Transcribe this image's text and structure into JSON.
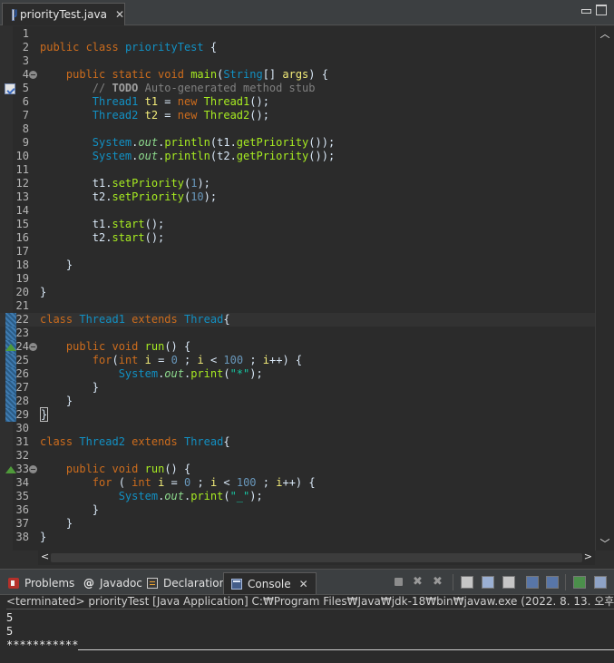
{
  "editor": {
    "tab_title": "priorityTest.java",
    "tab_close": "✕",
    "lines": [
      {
        "n": "1",
        "html": ""
      },
      {
        "n": "2",
        "html": "<span class=\"kw\">public class</span> <span class=\"cls\">priorityTest</span> {"
      },
      {
        "n": "3",
        "html": ""
      },
      {
        "n": "4",
        "html": "    <span class=\"kw\">public static void</span> <span class=\"method\">main</span>(<span class=\"cls\">String</span>[] <span class=\"var\">args</span>) {"
      },
      {
        "n": "5",
        "html": "        <span class=\"cmt\">// <span class=\"todo\">TODO</span> Auto-generated method stub</span>"
      },
      {
        "n": "6",
        "html": "        <span class=\"cls\">Thread1</span> <span class=\"var\">t1</span> = <span class=\"kw\">new</span> <span class=\"method\">Thread1</span>();"
      },
      {
        "n": "7",
        "html": "        <span class=\"cls\">Thread2</span> <span class=\"var\">t2</span> = <span class=\"kw\">new</span> <span class=\"method\">Thread2</span>();"
      },
      {
        "n": "8",
        "html": ""
      },
      {
        "n": "9",
        "html": "        <span class=\"cls\">System</span>.<span class=\"field\">out</span>.<span class=\"method\">println</span>(t1.<span class=\"method\">getPriority</span>());"
      },
      {
        "n": "10",
        "html": "        <span class=\"cls\">System</span>.<span class=\"field\">out</span>.<span class=\"method\">println</span>(t2.<span class=\"method\">getPriority</span>());"
      },
      {
        "n": "11",
        "html": ""
      },
      {
        "n": "12",
        "html": "        t1.<span class=\"method\">setPriority</span>(<span class=\"num\">1</span>);"
      },
      {
        "n": "13",
        "html": "        t2.<span class=\"method\">setPriority</span>(<span class=\"num\">10</span>);"
      },
      {
        "n": "14",
        "html": ""
      },
      {
        "n": "15",
        "html": "        t1.<span class=\"method\">start</span>();"
      },
      {
        "n": "16",
        "html": "        t2.<span class=\"method\">start</span>();"
      },
      {
        "n": "17",
        "html": ""
      },
      {
        "n": "18",
        "html": "    }"
      },
      {
        "n": "19",
        "html": ""
      },
      {
        "n": "20",
        "html": "}"
      },
      {
        "n": "21",
        "html": ""
      },
      {
        "n": "22",
        "html": "<span class=\"kw\">class</span> <span class=\"cls\">Thread1</span> <span class=\"kw\">extends</span> <span class=\"cls\">Thread</span>{"
      },
      {
        "n": "23",
        "html": ""
      },
      {
        "n": "24",
        "html": "    <span class=\"kw\">public void</span> <span class=\"method\">run</span>() {"
      },
      {
        "n": "25",
        "html": "        <span class=\"kw\">for</span>(<span class=\"kw\">int</span> <span class=\"var\">i</span> = <span class=\"num\">0</span> ; <span class=\"var\">i</span> &lt; <span class=\"num\">100</span> ; <span class=\"var\">i</span>++) {"
      },
      {
        "n": "26",
        "html": "            <span class=\"cls\">System</span>.<span class=\"field\">out</span>.<span class=\"method\">print</span>(<span class=\"str\">\"*\"</span>);"
      },
      {
        "n": "27",
        "html": "        }"
      },
      {
        "n": "28",
        "html": "    }"
      },
      {
        "n": "29",
        "html": "<span class=\"bracket-box\">}</span>"
      },
      {
        "n": "30",
        "html": ""
      },
      {
        "n": "31",
        "html": "<span class=\"kw\">class</span> <span class=\"cls\">Thread2</span> <span class=\"kw\">extends</span> <span class=\"cls\">Thread</span>{"
      },
      {
        "n": "32",
        "html": ""
      },
      {
        "n": "33",
        "html": "    <span class=\"kw\">public void</span> <span class=\"method\">run</span>() {"
      },
      {
        "n": "34",
        "html": "        <span class=\"kw\">for</span> ( <span class=\"kw\">int</span> <span class=\"var\">i</span> = <span class=\"num\">0</span> ; <span class=\"var\">i</span> &lt; <span class=\"num\">100</span> ; <span class=\"var\">i</span>++) {"
      },
      {
        "n": "35",
        "html": "            <span class=\"cls\">System</span>.<span class=\"field\">out</span>.<span class=\"method\">print</span>(<span class=\"str\">\"_\"</span>);"
      },
      {
        "n": "36",
        "html": "        }"
      },
      {
        "n": "37",
        "html": "    }"
      },
      {
        "n": "38",
        "html": "}"
      }
    ]
  },
  "views": {
    "tabs": [
      {
        "label": "Problems",
        "icon": "problems-icon"
      },
      {
        "label": "Javadoc",
        "icon": "javadoc-icon"
      },
      {
        "label": "Declaration",
        "icon": "declaration-icon"
      },
      {
        "label": "Console",
        "icon": "console-icon"
      }
    ],
    "tab_close": "✕",
    "javadoc_glyph": "@"
  },
  "console": {
    "status": "<terminated> priorityTest [Java Application] C:₩Program Files₩Java₩jdk-18₩bin₩javaw.exe  (2022. 8. 13. 오후 2:06:01 – 오",
    "output": [
      "5",
      "5",
      "***********"
    ]
  },
  "colors": {
    "keyword": "#cc6c1d",
    "class": "#1290c3",
    "method": "#a7ec21",
    "variable": "#f3ec79",
    "number": "#6897bb",
    "string": "#17c6a3",
    "background": "#2b2b2b"
  }
}
